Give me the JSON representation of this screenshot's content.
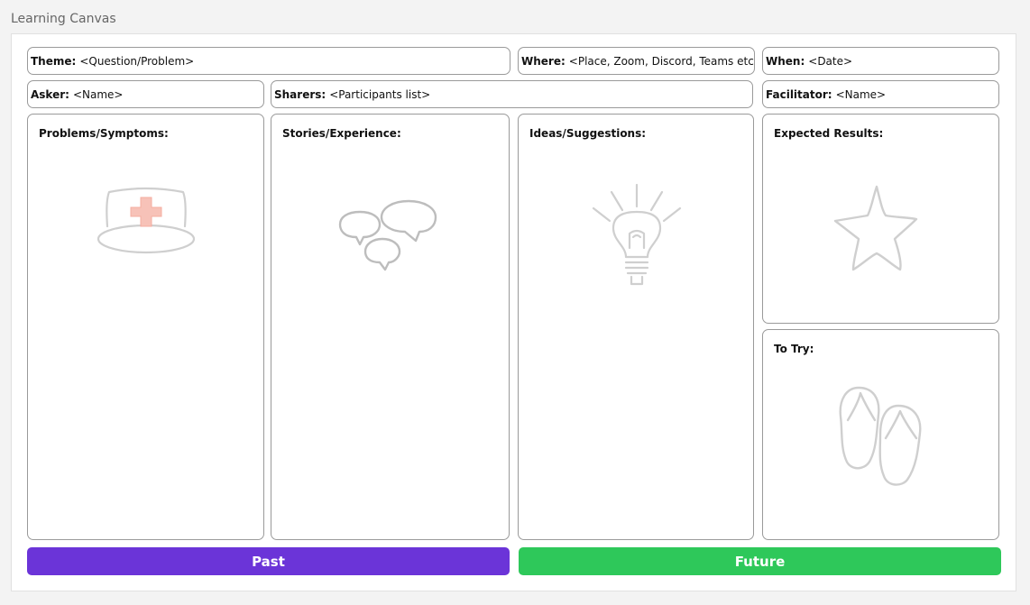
{
  "app": {
    "title": "Learning Canvas"
  },
  "fields": {
    "theme": {
      "label": "Theme:",
      "value": "<Question/Problem>"
    },
    "where": {
      "label": "Where:",
      "value": "<Place, Zoom, Discord, Teams etc>"
    },
    "when": {
      "label": "When:",
      "value": "<Date>"
    },
    "asker": {
      "label": "Asker:",
      "value": "<Name>"
    },
    "sharers": {
      "label": "Sharers:",
      "value": "<Participants list>"
    },
    "facilitator": {
      "label": "Facilitator:",
      "value": "<Name>"
    }
  },
  "panels": {
    "problems": {
      "title": "Problems/Symptoms:",
      "icon": "nurse-cap-icon"
    },
    "stories": {
      "title": "Stories/Experience:",
      "icon": "speech-bubbles-icon"
    },
    "ideas": {
      "title": "Ideas/Suggestions:",
      "icon": "lightbulb-icon"
    },
    "expected": {
      "title": "Expected Results:",
      "icon": "star-icon"
    },
    "totry": {
      "title": "To Try:",
      "icon": "flip-flops-icon"
    }
  },
  "footer": {
    "past": {
      "label": "Past",
      "color": "#6b34d8"
    },
    "future": {
      "label": "Future",
      "color": "#2ec85a"
    }
  }
}
